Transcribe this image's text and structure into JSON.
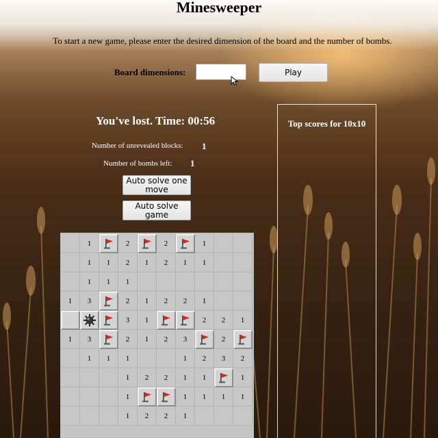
{
  "title": "Minesweeper",
  "intro": "To start a new game, please enter the desired dimension of the board and the number of bombs.",
  "setup": {
    "dimensions_label": "Board dimensions:",
    "dimensions_value": "",
    "play_label": "Play"
  },
  "game": {
    "status": "You've lost. Time: 00:56",
    "unrevealed_label": "Number of unrevealed blocks:",
    "unrevealed_value": "1",
    "bombs_left_label": "Number of bombs left:",
    "bombs_left_value": "1",
    "auto_solve_move_label": "Auto solve one move",
    "auto_solve_game_label": "Auto solve game"
  },
  "scores": {
    "title": "Top scores for 10x10"
  },
  "board": {
    "rows": 10,
    "cols": 10,
    "legend": {
      "F": "flag",
      "B": "bomb",
      "H": "hidden",
      "": "empty revealed"
    },
    "cells": [
      [
        "",
        "1",
        "F",
        "2",
        "F",
        "2",
        "F",
        "1",
        "",
        ""
      ],
      [
        "",
        "1",
        "1",
        "2",
        "1",
        "2",
        "1",
        "1",
        "",
        ""
      ],
      [
        "",
        "1",
        "1",
        "1",
        "",
        "",
        "",
        "",
        "",
        ""
      ],
      [
        "1",
        "3",
        "F",
        "2",
        "1",
        "2",
        "2",
        "1",
        "",
        ""
      ],
      [
        "H",
        "B",
        "F",
        "3",
        "1",
        "F",
        "F",
        "2",
        "2",
        "1"
      ],
      [
        "1",
        "3",
        "F",
        "2",
        "1",
        "2",
        "3",
        "F",
        "2",
        "F"
      ],
      [
        "",
        "1",
        "1",
        "1",
        "",
        "",
        "1",
        "2",
        "3",
        "2"
      ],
      [
        "",
        "",
        "",
        "1",
        "2",
        "2",
        "1",
        "1",
        "F",
        "1"
      ],
      [
        "",
        "",
        "",
        "1",
        "F",
        "F",
        "1",
        "1",
        "1",
        "1"
      ],
      [
        "",
        "",
        "",
        "1",
        "2",
        "2",
        "1",
        "",
        "",
        ""
      ]
    ]
  },
  "colors": {
    "flag_red": "#d9261c",
    "text_light": "#ffffff"
  }
}
